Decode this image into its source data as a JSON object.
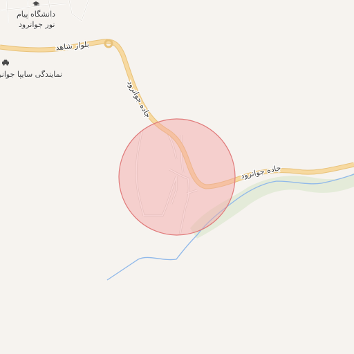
{
  "map": {
    "roads": [
      {
        "name": "بلوار شاهد",
        "label": "بلوار شاهد"
      },
      {
        "name": "جاده جوانرود",
        "label": "جاده جوانرود"
      },
      {
        "name": "جاده جوانرود",
        "label": "جاده جوانرود"
      }
    ],
    "pois": [
      {
        "label_line1": "دانشگاه پیام",
        "label_line2": "نور جوانرود",
        "icon": "graduation-cap-icon"
      },
      {
        "label": "نمایندگی سایپا جوانرود",
        "icon": "car-icon"
      }
    ],
    "highlight": {
      "shape": "circle",
      "fill": "#f4a3a3",
      "stroke": "#e07a7a"
    },
    "colors": {
      "background": "#f6f3ef",
      "road_major": "#f7d9a0",
      "road_major_casing": "#e8c27a",
      "road_minor": "#ffffff",
      "road_minor_casing": "#d6d2cc",
      "water": "#8fb8ea",
      "vegetation": "#dfe8d2"
    }
  }
}
